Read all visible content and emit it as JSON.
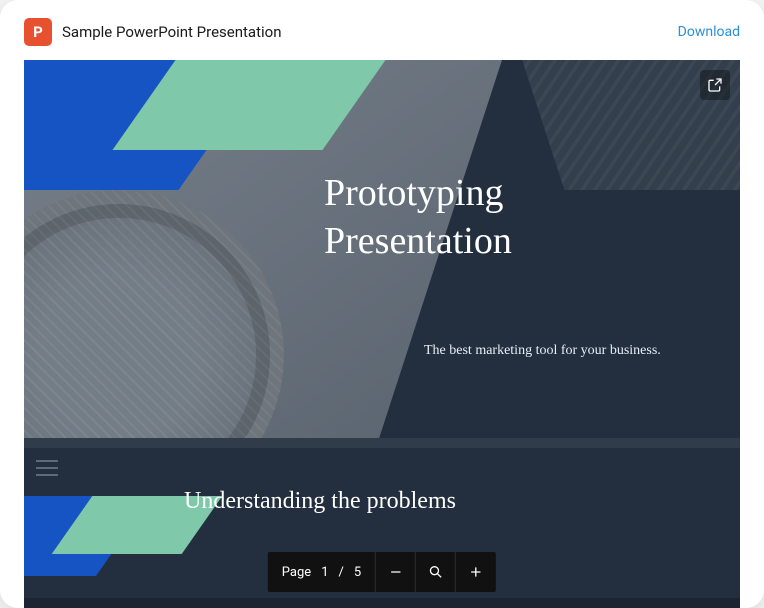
{
  "header": {
    "icon_letter": "P",
    "title": "Sample PowerPoint Presentation",
    "download_label": "Download"
  },
  "slide_main": {
    "title_line1": "Prototyping",
    "title_line2": "Presentation",
    "subtitle": "The best marketing tool for your business."
  },
  "slide_next": {
    "title": "Understanding the problems"
  },
  "toolbar": {
    "page_label": "Page",
    "current_page": "1",
    "separator": "/",
    "total_pages": "5"
  }
}
